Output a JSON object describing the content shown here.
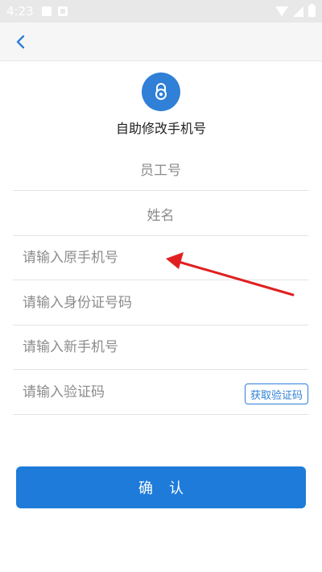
{
  "status_bar": {
    "time": "4:23",
    "icons": [
      "image-icon",
      "notification-icon",
      "wifi-icon",
      "signal-icon",
      "battery-icon"
    ]
  },
  "app_bar": {
    "back_icon": "chevron-left-icon",
    "accent_color": "#2f80d6"
  },
  "header": {
    "icon": "lock-icon",
    "title": "自助修改手机号"
  },
  "form": {
    "employee_id_label": "员工号",
    "name_label": "姓名",
    "old_phone_placeholder": "请输入原手机号",
    "id_card_placeholder": "请输入身份证号码",
    "new_phone_placeholder": "请输入新手机号",
    "code_placeholder": "请输入验证码",
    "get_code_label": "获取验证码"
  },
  "confirm": {
    "label": "确认",
    "color": "#1e7bd9"
  },
  "annotation": {
    "arrow_color": "#e02020"
  }
}
